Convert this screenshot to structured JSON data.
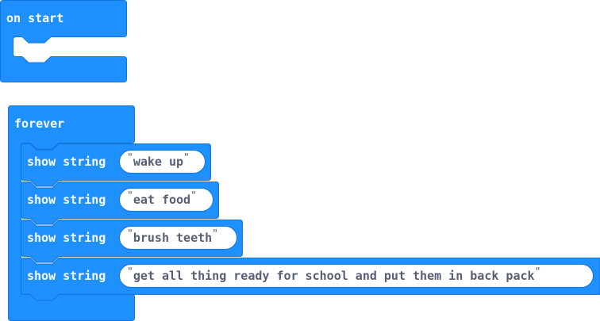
{
  "colors": {
    "block_fill": "#1E90FF",
    "block_border": "#1475D9",
    "input_text": "#575E75",
    "input_bg": "#ffffff"
  },
  "on_start": {
    "label": "on start"
  },
  "forever": {
    "label": "forever",
    "statements": [
      {
        "label": "show string",
        "value": "wake up"
      },
      {
        "label": "show string",
        "value": "eat food"
      },
      {
        "label": "show string",
        "value": "brush teeth"
      },
      {
        "label": "show string",
        "value": "get all thing ready for school and put them in back pack"
      }
    ]
  },
  "quote_open": "\"",
  "quote_close": "\""
}
